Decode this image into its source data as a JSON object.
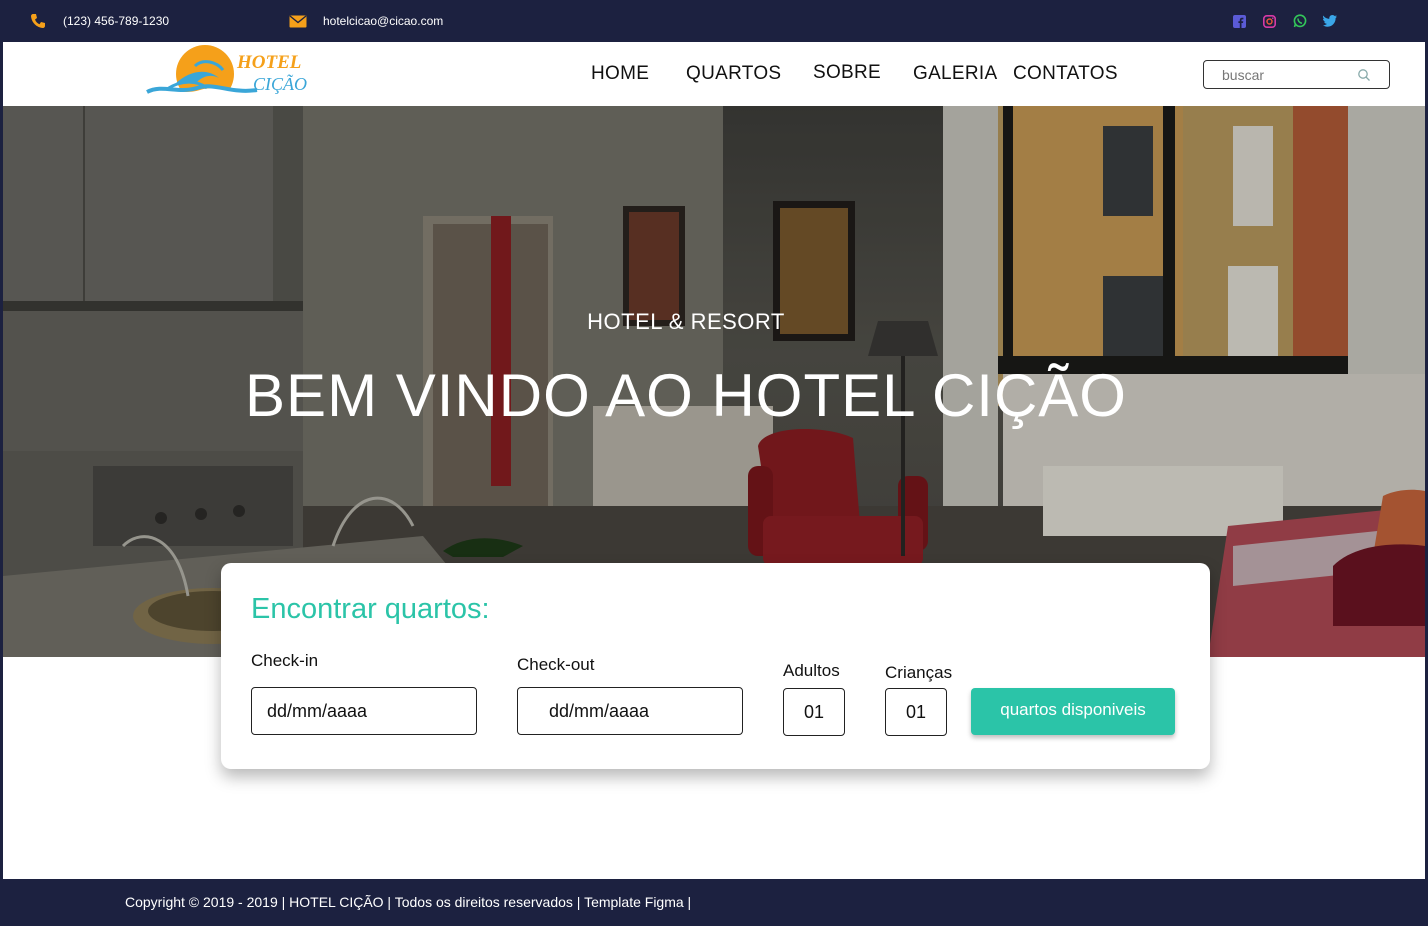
{
  "topbar": {
    "phone": "(123) 456-789-1230",
    "email": "hotelcicao@cicao.com",
    "icons": [
      "phone-icon",
      "mail-icon",
      "facebook-icon",
      "instagram-icon",
      "whatsapp-icon",
      "twitter-icon"
    ]
  },
  "logo": {
    "line1": "HOTEL",
    "line2": "CIÇÃO"
  },
  "nav": {
    "items": [
      {
        "label": "HOME"
      },
      {
        "label": "QUARTOS"
      },
      {
        "label": "SOBRE"
      },
      {
        "label": "GALERIA"
      },
      {
        "label": "CONTATOS"
      }
    ]
  },
  "search": {
    "placeholder": "buscar",
    "icon": "search-icon"
  },
  "hero": {
    "subtitle": "HOTEL & RESORT",
    "title": "BEM VINDO AO HOTEL CIÇÃO"
  },
  "booking": {
    "title": "Encontrar quartos:",
    "checkin_label": "Check-in",
    "checkin_value": "dd/mm/aaaa",
    "checkout_label": "Check-out",
    "checkout_value": "dd/mm/aaaa",
    "adults_label": "Adultos",
    "adults_value": "01",
    "children_label": "Crianças",
    "children_value": "01",
    "submit_label": "quartos disponiveis"
  },
  "footer": {
    "text": "Copyright © 2019 - 2019 | HOTEL CIÇÃO | Todos os direitos reservados | Template Figma |"
  },
  "colors": {
    "navy": "#1c2140",
    "accent": "#2bc4a8",
    "orange": "#f5a01a",
    "logo_blue": "#3aa6d8"
  }
}
